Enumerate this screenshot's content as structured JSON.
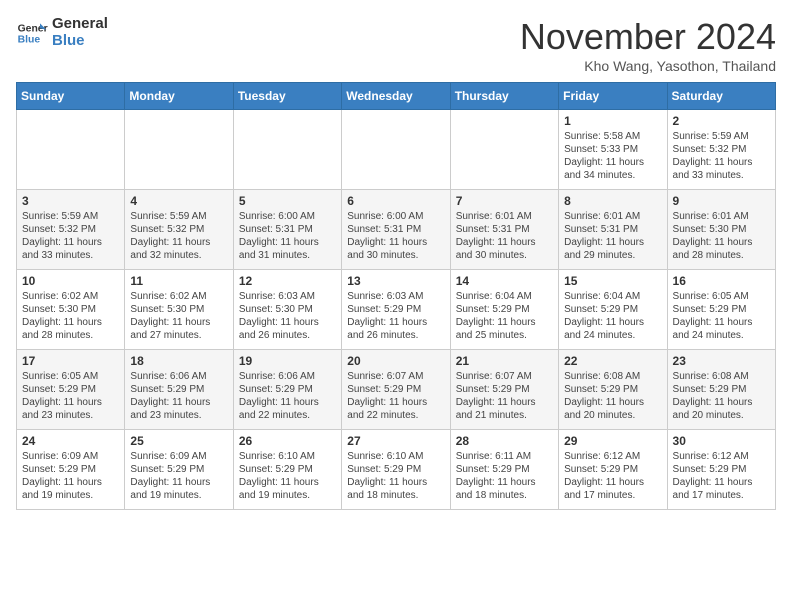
{
  "header": {
    "logo_line1": "General",
    "logo_line2": "Blue",
    "month": "November 2024",
    "location": "Kho Wang, Yasothon, Thailand"
  },
  "days_of_week": [
    "Sunday",
    "Monday",
    "Tuesday",
    "Wednesday",
    "Thursday",
    "Friday",
    "Saturday"
  ],
  "weeks": [
    [
      {
        "day": "",
        "info": ""
      },
      {
        "day": "",
        "info": ""
      },
      {
        "day": "",
        "info": ""
      },
      {
        "day": "",
        "info": ""
      },
      {
        "day": "",
        "info": ""
      },
      {
        "day": "1",
        "info": "Sunrise: 5:58 AM\nSunset: 5:33 PM\nDaylight: 11 hours and 34 minutes."
      },
      {
        "day": "2",
        "info": "Sunrise: 5:59 AM\nSunset: 5:32 PM\nDaylight: 11 hours and 33 minutes."
      }
    ],
    [
      {
        "day": "3",
        "info": "Sunrise: 5:59 AM\nSunset: 5:32 PM\nDaylight: 11 hours and 33 minutes."
      },
      {
        "day": "4",
        "info": "Sunrise: 5:59 AM\nSunset: 5:32 PM\nDaylight: 11 hours and 32 minutes."
      },
      {
        "day": "5",
        "info": "Sunrise: 6:00 AM\nSunset: 5:31 PM\nDaylight: 11 hours and 31 minutes."
      },
      {
        "day": "6",
        "info": "Sunrise: 6:00 AM\nSunset: 5:31 PM\nDaylight: 11 hours and 30 minutes."
      },
      {
        "day": "7",
        "info": "Sunrise: 6:01 AM\nSunset: 5:31 PM\nDaylight: 11 hours and 30 minutes."
      },
      {
        "day": "8",
        "info": "Sunrise: 6:01 AM\nSunset: 5:31 PM\nDaylight: 11 hours and 29 minutes."
      },
      {
        "day": "9",
        "info": "Sunrise: 6:01 AM\nSunset: 5:30 PM\nDaylight: 11 hours and 28 minutes."
      }
    ],
    [
      {
        "day": "10",
        "info": "Sunrise: 6:02 AM\nSunset: 5:30 PM\nDaylight: 11 hours and 28 minutes."
      },
      {
        "day": "11",
        "info": "Sunrise: 6:02 AM\nSunset: 5:30 PM\nDaylight: 11 hours and 27 minutes."
      },
      {
        "day": "12",
        "info": "Sunrise: 6:03 AM\nSunset: 5:30 PM\nDaylight: 11 hours and 26 minutes."
      },
      {
        "day": "13",
        "info": "Sunrise: 6:03 AM\nSunset: 5:29 PM\nDaylight: 11 hours and 26 minutes."
      },
      {
        "day": "14",
        "info": "Sunrise: 6:04 AM\nSunset: 5:29 PM\nDaylight: 11 hours and 25 minutes."
      },
      {
        "day": "15",
        "info": "Sunrise: 6:04 AM\nSunset: 5:29 PM\nDaylight: 11 hours and 24 minutes."
      },
      {
        "day": "16",
        "info": "Sunrise: 6:05 AM\nSunset: 5:29 PM\nDaylight: 11 hours and 24 minutes."
      }
    ],
    [
      {
        "day": "17",
        "info": "Sunrise: 6:05 AM\nSunset: 5:29 PM\nDaylight: 11 hours and 23 minutes."
      },
      {
        "day": "18",
        "info": "Sunrise: 6:06 AM\nSunset: 5:29 PM\nDaylight: 11 hours and 23 minutes."
      },
      {
        "day": "19",
        "info": "Sunrise: 6:06 AM\nSunset: 5:29 PM\nDaylight: 11 hours and 22 minutes."
      },
      {
        "day": "20",
        "info": "Sunrise: 6:07 AM\nSunset: 5:29 PM\nDaylight: 11 hours and 22 minutes."
      },
      {
        "day": "21",
        "info": "Sunrise: 6:07 AM\nSunset: 5:29 PM\nDaylight: 11 hours and 21 minutes."
      },
      {
        "day": "22",
        "info": "Sunrise: 6:08 AM\nSunset: 5:29 PM\nDaylight: 11 hours and 20 minutes."
      },
      {
        "day": "23",
        "info": "Sunrise: 6:08 AM\nSunset: 5:29 PM\nDaylight: 11 hours and 20 minutes."
      }
    ],
    [
      {
        "day": "24",
        "info": "Sunrise: 6:09 AM\nSunset: 5:29 PM\nDaylight: 11 hours and 19 minutes."
      },
      {
        "day": "25",
        "info": "Sunrise: 6:09 AM\nSunset: 5:29 PM\nDaylight: 11 hours and 19 minutes."
      },
      {
        "day": "26",
        "info": "Sunrise: 6:10 AM\nSunset: 5:29 PM\nDaylight: 11 hours and 19 minutes."
      },
      {
        "day": "27",
        "info": "Sunrise: 6:10 AM\nSunset: 5:29 PM\nDaylight: 11 hours and 18 minutes."
      },
      {
        "day": "28",
        "info": "Sunrise: 6:11 AM\nSunset: 5:29 PM\nDaylight: 11 hours and 18 minutes."
      },
      {
        "day": "29",
        "info": "Sunrise: 6:12 AM\nSunset: 5:29 PM\nDaylight: 11 hours and 17 minutes."
      },
      {
        "day": "30",
        "info": "Sunrise: 6:12 AM\nSunset: 5:29 PM\nDaylight: 11 hours and 17 minutes."
      }
    ]
  ]
}
